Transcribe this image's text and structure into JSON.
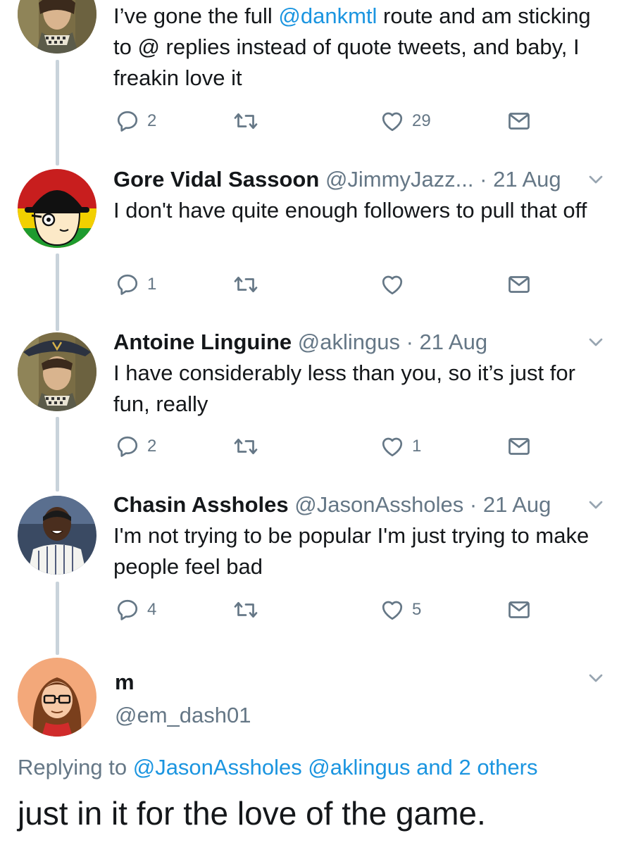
{
  "tweets": [
    {
      "name": "",
      "handle": "",
      "time": "",
      "text_before": "I’ve gone the full ",
      "text_mention": "@dankmtl",
      "text_after": " route and am sticking to @ replies instead of quote tweets, and baby, I freakin love it",
      "replies": "2",
      "retweets": "",
      "likes": "29"
    },
    {
      "name": "Gore Vidal Sassoon",
      "handle": "@JimmyJazz...",
      "time": "· 21 Aug",
      "text": "I don't have quite enough followers to pull that off",
      "replies": "1",
      "retweets": "",
      "likes": ""
    },
    {
      "name": "Antoine Linguine",
      "handle": "@aklingus",
      "time": "· 21 Aug",
      "text": "I have considerably less than you, so it’s just for fun, really",
      "replies": "2",
      "retweets": "",
      "likes": "1"
    },
    {
      "name": "Chasin Assholes",
      "handle": "@JasonAssholes",
      "time": "· 21 Aug",
      "text": "I'm not trying to be popular I'm just trying to make people feel bad",
      "replies": "4",
      "retweets": "",
      "likes": "5"
    }
  ],
  "main_tweet": {
    "name": "m",
    "handle": "@em_dash01",
    "replying_prefix": "Replying to ",
    "replying_to": "@JasonAssholes @aklingus and 2 others",
    "text": "just in it for the love of the game."
  },
  "icons": {
    "reply": "reply-icon",
    "retweet": "retweet-icon",
    "like": "heart-icon",
    "dm": "envelope-icon",
    "menu": "chevron-down-icon"
  },
  "colors": {
    "text": "#14171a",
    "muted": "#657786",
    "link": "#1b95e0",
    "thread": "#c9d3db"
  }
}
